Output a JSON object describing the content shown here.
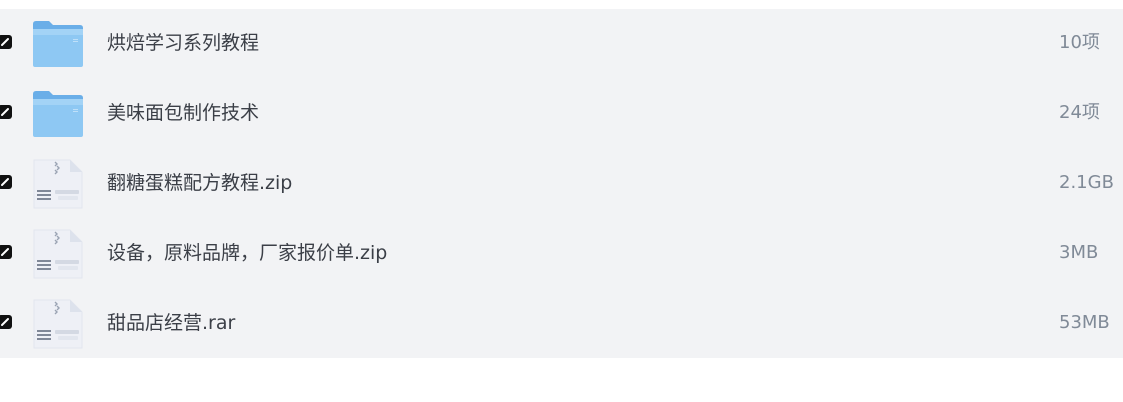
{
  "files": [
    {
      "type": "folder",
      "icon": "folder-icon",
      "name": "烘焙学习系列教程",
      "size": "10项",
      "checked": true
    },
    {
      "type": "folder",
      "icon": "folder-icon",
      "name": "美味面包制作技术",
      "size": "24项",
      "checked": true
    },
    {
      "type": "archive",
      "icon": "zip-file-icon",
      "name": "翻糖蛋糕配方教程.zip",
      "size": "2.1GB",
      "checked": true
    },
    {
      "type": "archive",
      "icon": "zip-file-icon",
      "name": "设备，原料品牌，厂家报价单.zip",
      "size": "3MB",
      "checked": true
    },
    {
      "type": "archive",
      "icon": "zip-file-icon",
      "name": "甜品店经营.rar",
      "size": "53MB",
      "checked": true
    }
  ],
  "colors": {
    "list_background": "#f2f3f5",
    "name_text": "#3b3f47",
    "size_text": "#808a97",
    "checkbox": "#111111",
    "folder_main": "#8ec8f3",
    "folder_back": "#6aaee8",
    "archive_body": "#eef0f6"
  }
}
